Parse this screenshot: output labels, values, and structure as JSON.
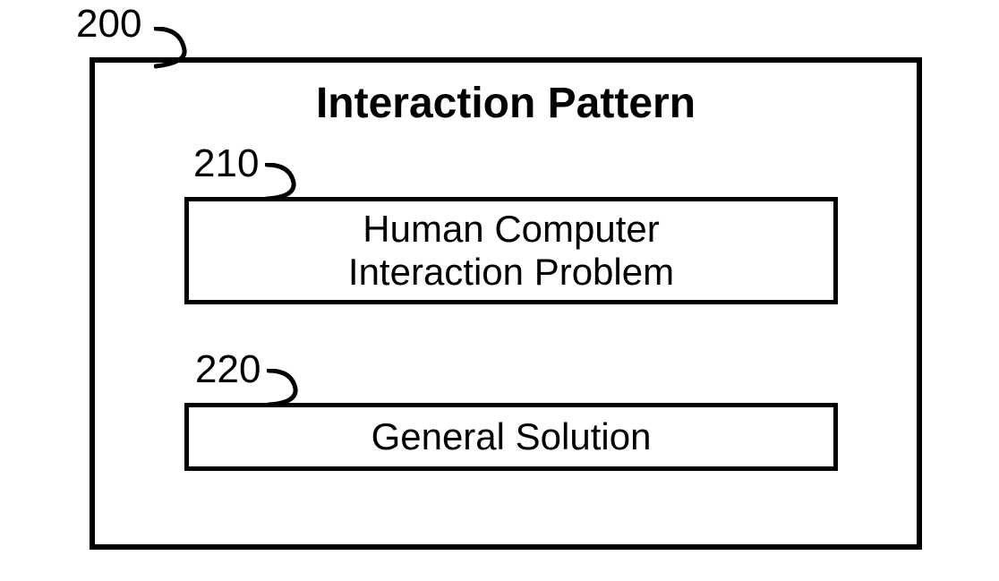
{
  "diagram": {
    "outer_ref": "200",
    "title": "Interaction Pattern",
    "boxes": {
      "problem": {
        "ref": "210",
        "text": "Human Computer\nInteraction Problem"
      },
      "solution": {
        "ref": "220",
        "text": "General Solution"
      }
    }
  }
}
